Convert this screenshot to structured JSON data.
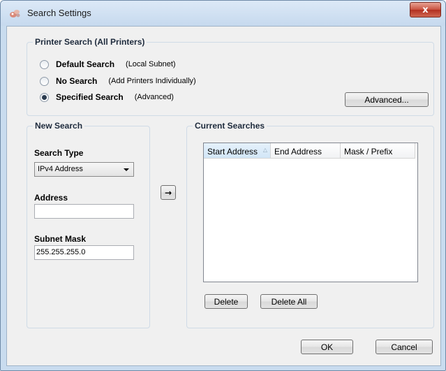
{
  "window": {
    "title": "Search Settings",
    "close_label": "x"
  },
  "printer_search": {
    "legend": "Printer Search (All Printers)",
    "options": [
      {
        "label": "Default Search",
        "desc": "(Local Subnet)",
        "checked": false
      },
      {
        "label": "No Search",
        "desc": "(Add Printers Individually)",
        "checked": false
      },
      {
        "label": "Specified Search",
        "desc": "(Advanced)",
        "checked": true
      }
    ],
    "advanced_button": "Advanced..."
  },
  "new_search": {
    "legend": "New Search",
    "search_type_label": "Search Type",
    "search_type_value": "IPv4 Address",
    "address_label": "Address",
    "address_value": "",
    "subnet_label": "Subnet Mask",
    "subnet_value": "255.255.255.0"
  },
  "add_arrow": "→",
  "current_searches": {
    "legend": "Current Searches",
    "columns": [
      "Start Address",
      "End Address",
      "Mask / Prefix"
    ],
    "sort_indicator": "△",
    "rows": [],
    "delete_button": "Delete",
    "delete_all_button": "Delete All"
  },
  "footer": {
    "ok": "OK",
    "cancel": "Cancel"
  }
}
